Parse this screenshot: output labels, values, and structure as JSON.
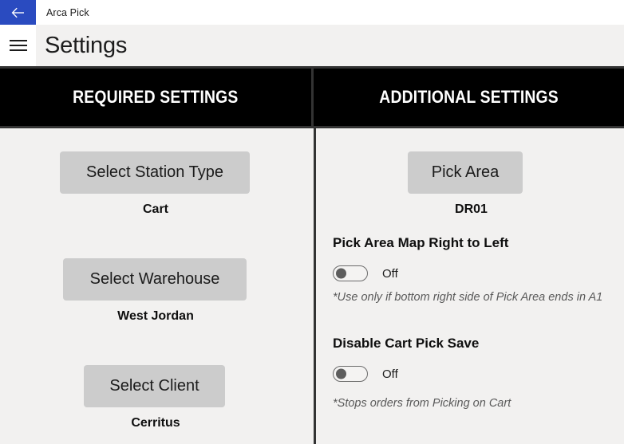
{
  "titlebar": {
    "back_icon": "back-arrow-icon",
    "app_name": "Arca Pick",
    "accent_color": "#2a4bc0"
  },
  "commandbar": {
    "menu_icon": "hamburger-menu-icon",
    "page_title": "Settings"
  },
  "columns": {
    "left": {
      "header": "REQUIRED SETTINGS",
      "items": [
        {
          "button_label": "Select Station Type",
          "value": "Cart"
        },
        {
          "button_label": "Select Warehouse",
          "value": "West Jordan"
        },
        {
          "button_label": "Select Client",
          "value": "Cerritus"
        }
      ]
    },
    "right": {
      "header": "ADDITIONAL SETTINGS",
      "pick_area": {
        "button_label": "Pick Area",
        "value": "DR01"
      },
      "options": [
        {
          "title": "Pick Area Map Right to Left",
          "state": "Off",
          "note": "*Use only if bottom right side of Pick Area ends in A1"
        },
        {
          "title": "Disable Cart Pick Save",
          "state": "Off",
          "note": "*Stops orders from Picking on Cart"
        }
      ]
    }
  },
  "colors": {
    "header_band": "#000000",
    "divider": "#333333",
    "button": "#cccccc",
    "page_background": "#f2f1f0"
  }
}
